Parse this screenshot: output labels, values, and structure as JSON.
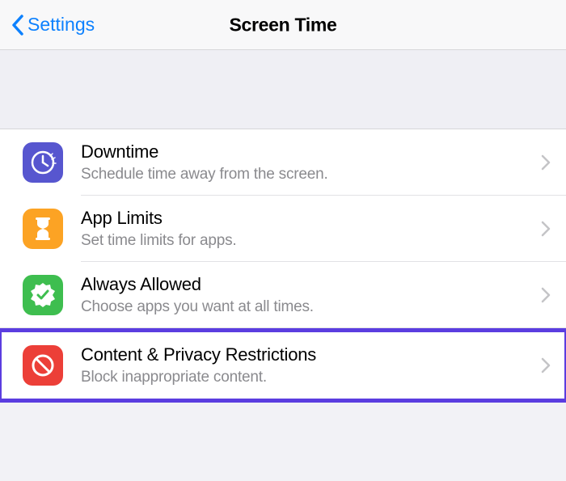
{
  "navbar": {
    "back_label": "Settings",
    "title": "Screen Time"
  },
  "rows": {
    "downtime": {
      "title": "Downtime",
      "subtitle": "Schedule time away from the screen."
    },
    "applimits": {
      "title": "App Limits",
      "subtitle": "Set time limits for apps."
    },
    "always": {
      "title": "Always Allowed",
      "subtitle": "Choose apps you want at all times."
    },
    "content": {
      "title": "Content & Privacy Restrictions",
      "subtitle": "Block inappropriate content."
    }
  }
}
